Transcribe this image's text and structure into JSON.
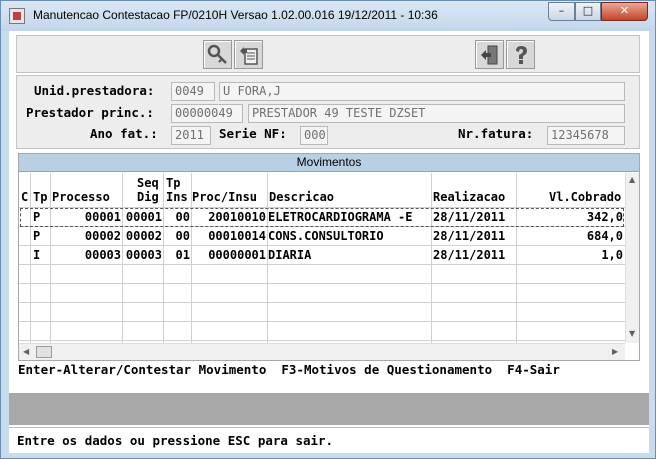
{
  "window": {
    "title": "Manutencao Contestacao FP/0210H Versao 1.02.00.016 19/12/2011 - 10:36",
    "min_glyph": "–",
    "max_glyph": "□",
    "close_glyph": "✕"
  },
  "toolbar": {
    "buttons": [
      "key-icon",
      "document-edit-icon",
      "exit-door-icon",
      "help-icon"
    ]
  },
  "form": {
    "unid_label": "Unid.prestadora:",
    "unid_code": "0049",
    "unid_name": "U FORA,J",
    "prest_label": "Prestador princ.:",
    "prest_code": "00000049",
    "prest_name": "PRESTADOR 49 TESTE DZSET",
    "ano_label": "Ano fat.:",
    "ano_value": "2011",
    "serie_label": "Serie NF:",
    "serie_value": "000",
    "nrfatura_label": "Nr.fatura:",
    "nrfatura_value": "12345678"
  },
  "grid": {
    "title": "Movimentos",
    "headers": {
      "c": "C",
      "tp": "Tp",
      "processo": "Processo",
      "seq_dig_1": "Seq",
      "seq_dig_2": "Dig",
      "tp_ins_1": "Tp",
      "tp_ins_2": "Ins",
      "proc_insu": "Proc/Insu",
      "descricao": "Descricao",
      "realizacao": "Realizacao",
      "vl_cobrado": "Vl.Cobrado"
    },
    "rows": [
      {
        "c": "",
        "tp": "P",
        "processo": "00001",
        "seq_dig": "00001",
        "tp_ins": "00",
        "proc_insu": "20010010",
        "descricao": "ELETROCARDIOGRAMA -E",
        "realizacao": "28/11/2011",
        "vl_cobrado": "342,0"
      },
      {
        "c": "",
        "tp": "P",
        "processo": "00002",
        "seq_dig": "00002",
        "tp_ins": "00",
        "proc_insu": "00010014",
        "descricao": "CONS.CONSULTORIO",
        "realizacao": "28/11/2011",
        "vl_cobrado": "684,0"
      },
      {
        "c": "",
        "tp": "I",
        "processo": "00003",
        "seq_dig": "00003",
        "tp_ins": "01",
        "proc_insu": "00000001",
        "descricao": "DIARIA",
        "realizacao": "28/11/2011",
        "vl_cobrado": "1,0"
      }
    ],
    "selected_row": 0
  },
  "hint": "Enter-Alterar/Contestar Movimento  F3-Motivos de Questionamento  F4-Sair",
  "status": "Entre os dados ou pressione ESC para sair."
}
